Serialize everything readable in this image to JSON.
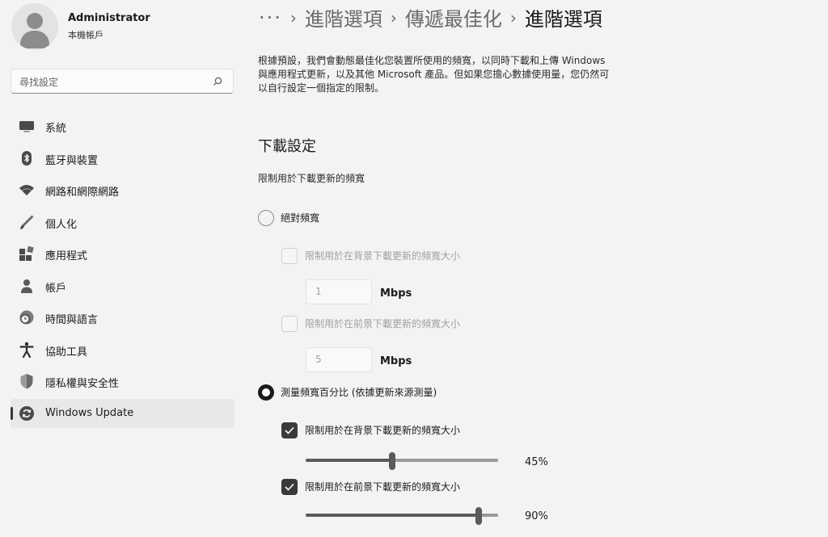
{
  "user": {
    "name": "Administrator",
    "account_type": "本機帳戶"
  },
  "search": {
    "placeholder": "尋找設定",
    "icon": "search-icon"
  },
  "sidebar": {
    "items": [
      {
        "label": "系統",
        "icon": "system-icon",
        "active": false
      },
      {
        "label": "藍牙與裝置",
        "icon": "bluetooth-icon",
        "active": false
      },
      {
        "label": "網路和網際網路",
        "icon": "wifi-icon",
        "active": false
      },
      {
        "label": "個人化",
        "icon": "brush-icon",
        "active": false
      },
      {
        "label": "應用程式",
        "icon": "apps-icon",
        "active": false
      },
      {
        "label": "帳戶",
        "icon": "person-icon",
        "active": false
      },
      {
        "label": "時間與語言",
        "icon": "clock-globe-icon",
        "active": false
      },
      {
        "label": "協助工具",
        "icon": "accessibility-icon",
        "active": false
      },
      {
        "label": "隱私權與安全性",
        "icon": "shield-icon",
        "active": false
      },
      {
        "label": "Windows Update",
        "icon": "update-icon",
        "active": true
      }
    ]
  },
  "breadcrumb": {
    "more": "···",
    "item1": "進階選項",
    "item2": "傳遞最佳化",
    "current": "進階選項"
  },
  "description": "根據預設，我們會動態最佳化您裝置所使用的頻寬，以同時下載和上傳 Windows 與應用程式更新，以及其他 Microsoft 產品。但如果您擔心數據使用量，您仍然可以自行設定一個指定的限制。",
  "download": {
    "title": "下載設定",
    "subtitle": "限制用於下載更新的頻寬",
    "absolute": {
      "label": "絕對頻寬",
      "selected": false,
      "background": {
        "label": "限制用於在背景下載更新的頻寬大小",
        "checked": false,
        "value": "1",
        "unit": "Mbps"
      },
      "foreground": {
        "label": "限制用於在前景下載更新的頻寬大小",
        "checked": false,
        "value": "5",
        "unit": "Mbps"
      }
    },
    "percentage": {
      "label": "測量頻寬百分比 (依據更新來源測量)",
      "selected": true,
      "background": {
        "label": "限制用於在背景下載更新的頻寬大小",
        "checked": true,
        "percent": 45,
        "value_text": "45%"
      },
      "foreground": {
        "label": "限制用於在前景下載更新的頻寬大小",
        "checked": true,
        "percent": 90,
        "value_text": "90%"
      }
    }
  },
  "colors": {
    "accent": "#1b1b1b",
    "background": "#f3f3f3",
    "disabled_text": "#a0a0a0"
  }
}
